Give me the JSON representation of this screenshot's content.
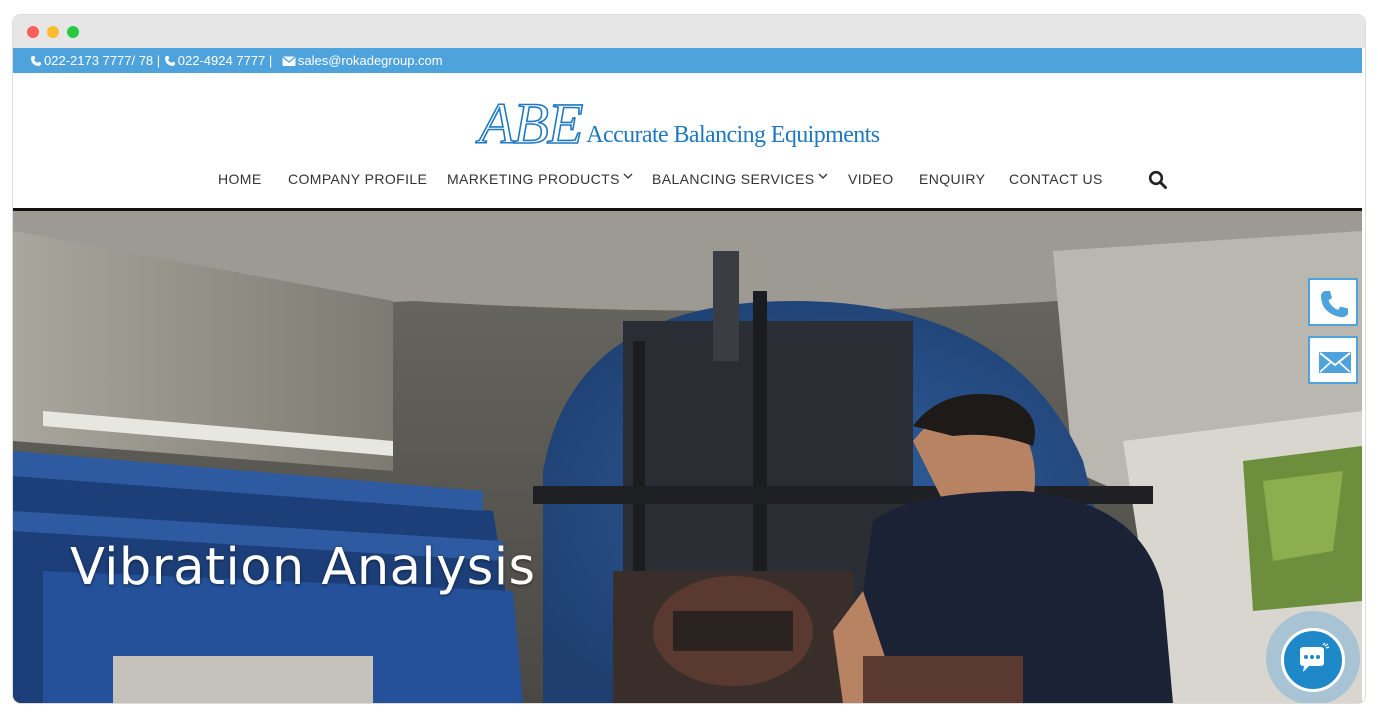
{
  "topbar": {
    "phone1": "022-2173 7777/ 78 |",
    "phone2": "022-4924 7777 |",
    "email": "sales@rokadegroup.com"
  },
  "logo": {
    "mark": "ABE",
    "text": "Accurate Balancing Equipments"
  },
  "nav": {
    "items": [
      {
        "label": "HOME"
      },
      {
        "label": "COMPANY PROFILE"
      },
      {
        "label": "MARKETING PRODUCTS"
      },
      {
        "label": "BALANCING SERVICES"
      },
      {
        "label": "VIDEO"
      },
      {
        "label": "ENQUIRY"
      },
      {
        "label": "CONTACT US"
      }
    ],
    "search_icon": "search-icon"
  },
  "hero": {
    "title": "Vibration Analysis"
  },
  "floating": {
    "phone_icon": "phone-icon",
    "mail_icon": "mail-icon",
    "chat_icon": "chat-icon"
  },
  "colors": {
    "topbar": "#4fa3dc",
    "brand": "#1f78c1",
    "nav_text": "#333333"
  }
}
